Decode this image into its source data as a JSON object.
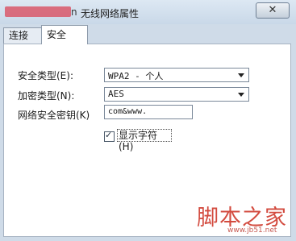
{
  "window": {
    "title_prefix_tail": "n",
    "title": "无线网络属性",
    "close_symbol": "✕"
  },
  "tabs": [
    {
      "label": "连接"
    },
    {
      "label": "安全"
    }
  ],
  "security": {
    "type_label": "安全类型(E):",
    "type_value": "WPA2 - 个人",
    "encryption_label": "加密类型(N):",
    "encryption_value": "AES",
    "key_label": "网络安全密钥(K)",
    "key_value": "com&www.",
    "show_chars_label": "显示字符(H)",
    "show_chars_checked": true
  },
  "watermark": {
    "text": "脚本之家",
    "url": "www.jb51.net"
  }
}
